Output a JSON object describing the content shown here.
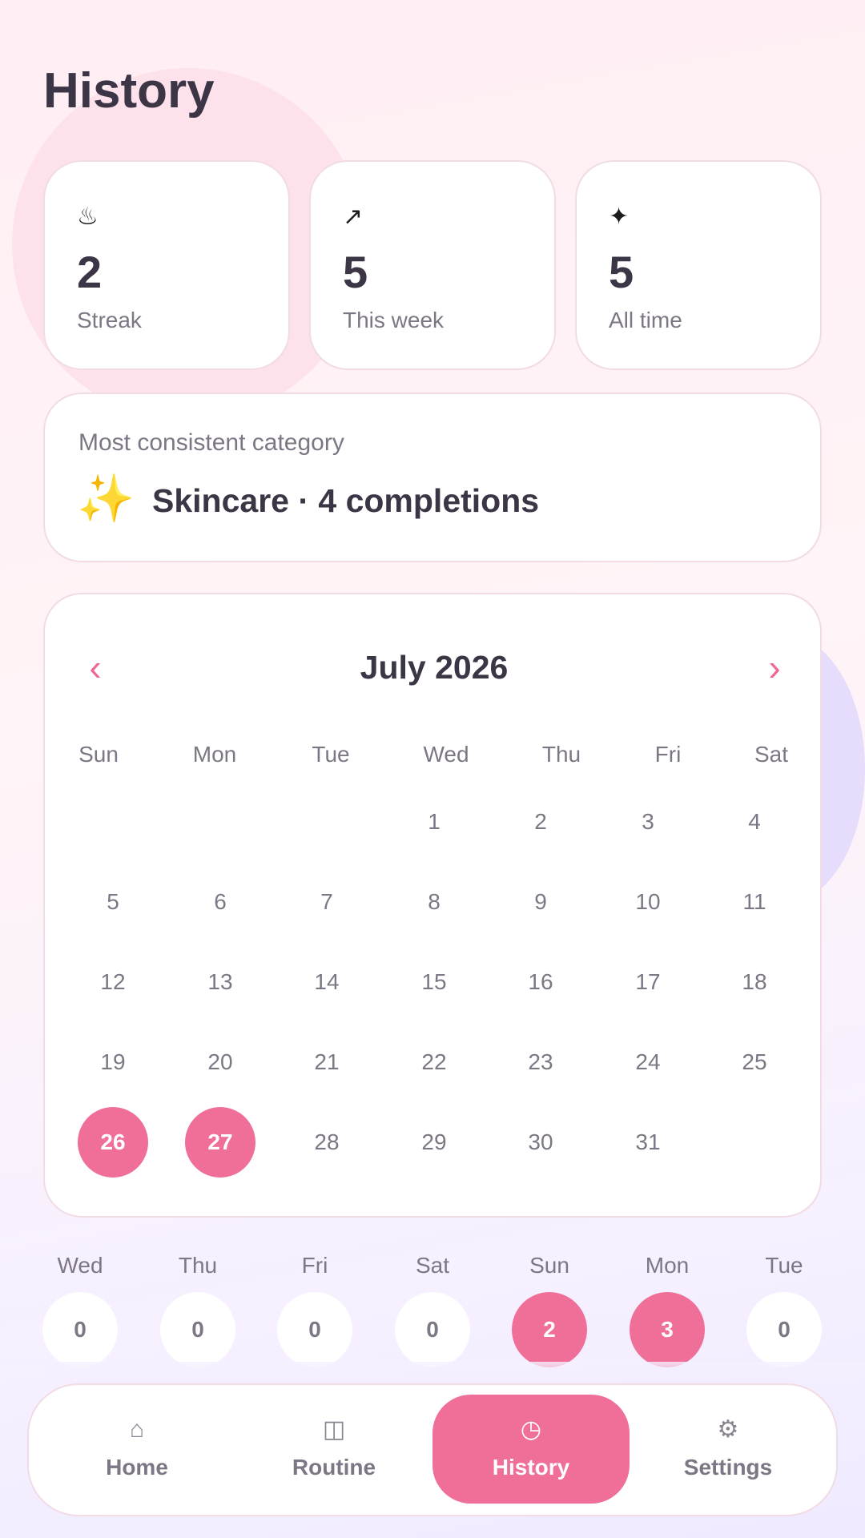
{
  "page_title": "History",
  "stats": [
    {
      "icon": "♨",
      "value": "2",
      "label": "Streak"
    },
    {
      "icon": "↗",
      "value": "5",
      "label": "This week"
    },
    {
      "icon": "✦",
      "value": "5",
      "label": "All time"
    }
  ],
  "consistent": {
    "heading": "Most consistent category",
    "emoji": "✨",
    "text": "Skincare · 4 completions"
  },
  "calendar": {
    "title": "July 2026",
    "prev": "‹",
    "next": "›",
    "weekdays": [
      "Sun",
      "Mon",
      "Tue",
      "Wed",
      "Thu",
      "Fri",
      "Sat"
    ],
    "days": [
      "",
      "",
      "",
      "1",
      "2",
      "3",
      "4",
      "5",
      "6",
      "7",
      "8",
      "9",
      "10",
      "11",
      "12",
      "13",
      "14",
      "15",
      "16",
      "17",
      "18",
      "19",
      "20",
      "21",
      "22",
      "23",
      "24",
      "25",
      "26",
      "27",
      "28",
      "29",
      "30",
      "31",
      ""
    ],
    "completed_days": [
      "26",
      "27"
    ]
  },
  "week": [
    {
      "day": "Wed",
      "count": "0",
      "active": false
    },
    {
      "day": "Thu",
      "count": "0",
      "active": false
    },
    {
      "day": "Fri",
      "count": "0",
      "active": false
    },
    {
      "day": "Sat",
      "count": "0",
      "active": false
    },
    {
      "day": "Sun",
      "count": "2",
      "active": true
    },
    {
      "day": "Mon",
      "count": "3",
      "active": true
    },
    {
      "day": "Tue",
      "count": "0",
      "active": false
    }
  ],
  "nav": [
    {
      "icon": "⌂",
      "label": "Home",
      "active": false
    },
    {
      "icon": "◫",
      "label": "Routine",
      "active": false
    },
    {
      "icon": "◷",
      "label": "History",
      "active": true
    },
    {
      "icon": "⚙",
      "label": "Settings",
      "active": false
    }
  ],
  "colors": {
    "accent": "#ef6f98",
    "text": "#3b3545",
    "muted": "#7d7684"
  }
}
